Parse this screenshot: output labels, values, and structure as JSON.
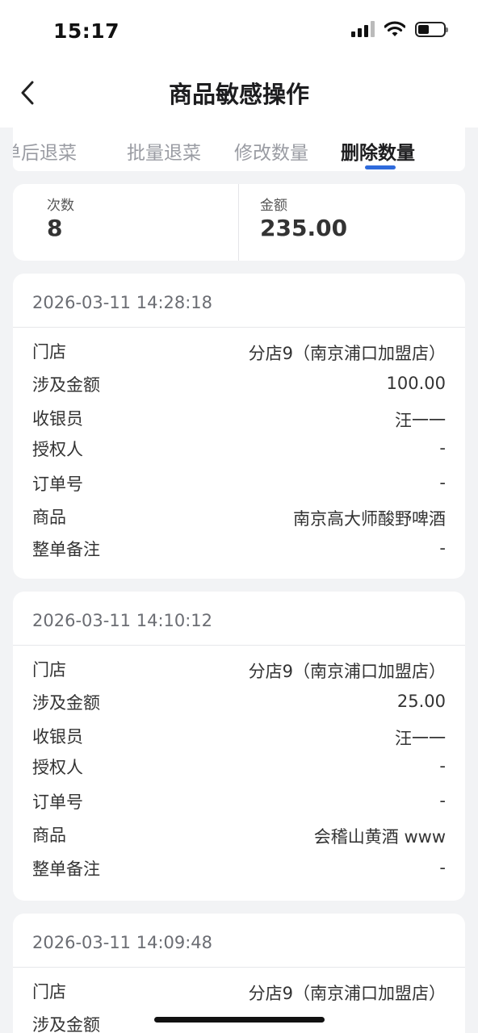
{
  "status_bar": {
    "time": "15:17"
  },
  "nav": {
    "title": "商品敏感操作"
  },
  "tabs": [
    {
      "label": "单后退菜"
    },
    {
      "label": "批量退菜"
    },
    {
      "label": "修改数量"
    },
    {
      "label": "删除数量",
      "active": true
    }
  ],
  "summary": {
    "count_label": "次数",
    "count_value": "8",
    "amount_label": "金额",
    "amount_value": "235.00"
  },
  "records": [
    {
      "time": "2026-03-11 14:28:18",
      "fields": [
        {
          "label": "门店",
          "value": "分店9（南京浦口加盟店）"
        },
        {
          "label": "涉及金额",
          "value": "100.00"
        },
        {
          "label": "收银员",
          "value": "汪一一"
        },
        {
          "label": "授权人",
          "value": "-"
        },
        {
          "label": "订单号",
          "value": "-"
        },
        {
          "label": "商品",
          "value": "南京高大师酸野啤酒"
        },
        {
          "label": "整单备注",
          "value": "-"
        }
      ]
    },
    {
      "time": "2026-03-11 14:10:12",
      "fields": [
        {
          "label": "门店",
          "value": "分店9（南京浦口加盟店）"
        },
        {
          "label": "涉及金额",
          "value": "25.00"
        },
        {
          "label": "收银员",
          "value": "汪一一"
        },
        {
          "label": "授权人",
          "value": "-"
        },
        {
          "label": "订单号",
          "value": "-"
        },
        {
          "label": "商品",
          "value": "会稽山黄酒 www"
        },
        {
          "label": "整单备注",
          "value": "-"
        }
      ]
    },
    {
      "time": "2026-03-11 14:09:48",
      "fields": [
        {
          "label": "门店",
          "value": "分店9（南京浦口加盟店）"
        },
        {
          "label": "涉及金额",
          "value": ""
        }
      ]
    }
  ]
}
